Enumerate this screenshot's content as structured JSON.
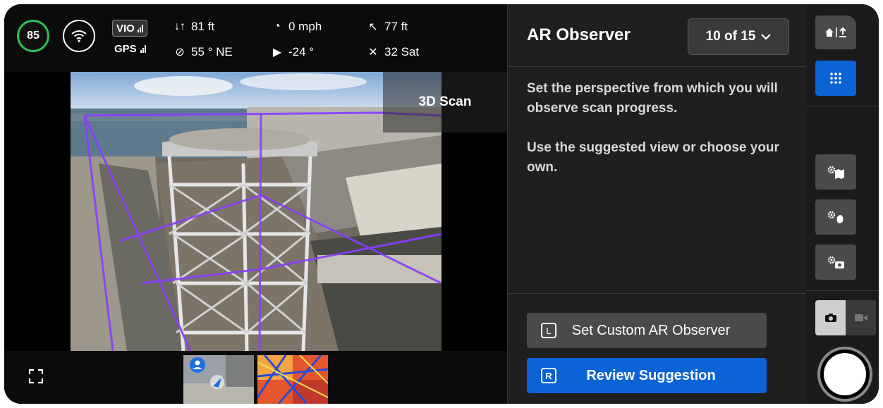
{
  "telemetry": {
    "battery": "85",
    "vio_label": "VIO",
    "gps_label": "GPS",
    "altitude": "81 ft",
    "heading": "55 ° NE",
    "speed": "0 mph",
    "gimbal_pitch": "-24 °",
    "distance": "77 ft",
    "satellites": "32 Sat"
  },
  "camera": {
    "mode_label": "3D Scan"
  },
  "panel": {
    "title": "AR Observer",
    "counter": "10 of 15",
    "description": [
      "Set the perspective from which you will observe scan progress.",
      "Use the suggested view or choose your own."
    ],
    "custom_button": {
      "key": "L",
      "label": "Set Custom AR Observer"
    },
    "review_button": {
      "key": "R",
      "label": "Review Suggestion"
    }
  },
  "colors": {
    "accent": "#0c63d6",
    "battery_ring": "#2fbf53",
    "scan_path": "#8b3dff"
  }
}
